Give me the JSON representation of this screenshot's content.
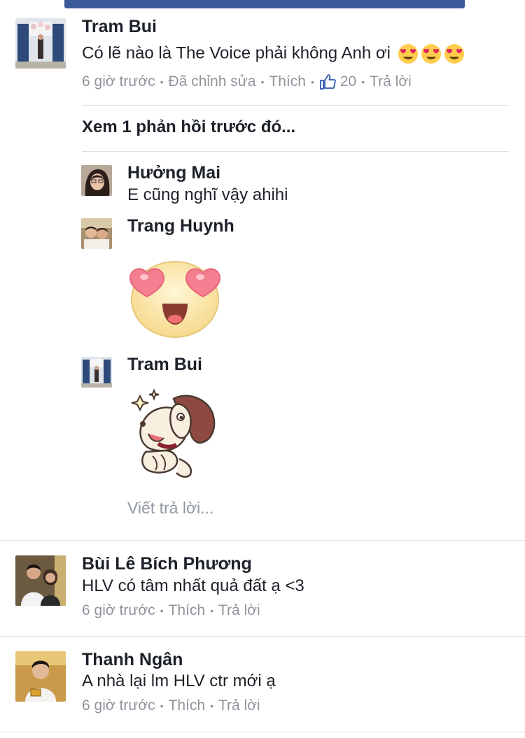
{
  "comments": [
    {
      "name": "Tram Bui",
      "text": "Có lẽ nào là The Voice phải không Anh ơi",
      "meta": {
        "time": "6 giờ trước",
        "edited": "Đã chỉnh sửa",
        "like": "Thích",
        "like_count": "20",
        "reply": "Trả lời"
      }
    },
    {
      "name": "Bùi Lê Bích Phương",
      "text": "HLV có tâm nhất quả đất ạ <3",
      "meta": {
        "time": "6 giờ trước",
        "like": "Thích",
        "reply": "Trả lời"
      }
    },
    {
      "name": "Thanh Ngân",
      "text": "A nhà lại lm HLV ctr mới ạ",
      "meta": {
        "time": "6 giờ trước",
        "like": "Thích",
        "reply": "Trả lời"
      }
    }
  ],
  "see_more": "Xem 1 phản hồi trước đó...",
  "replies": [
    {
      "name": "Hưởng Mai",
      "text": "E cũng nghĩ vậy ahihi"
    },
    {
      "name": "Trang Huynh"
    },
    {
      "name": "Tram Bui"
    }
  ],
  "reply_input": {
    "placeholder": "Viết trả lời..."
  },
  "icons": {
    "heart_eyes": "heart-eyes-emoji",
    "thumbs_up": "thumbs-up-icon",
    "sticker_heart_eyes": "heart-eyes-sticker",
    "sticker_dog": "dog-sticker"
  },
  "colors": {
    "brand": "#3b5998",
    "meta": "#90949c",
    "link": "#4267b2"
  }
}
